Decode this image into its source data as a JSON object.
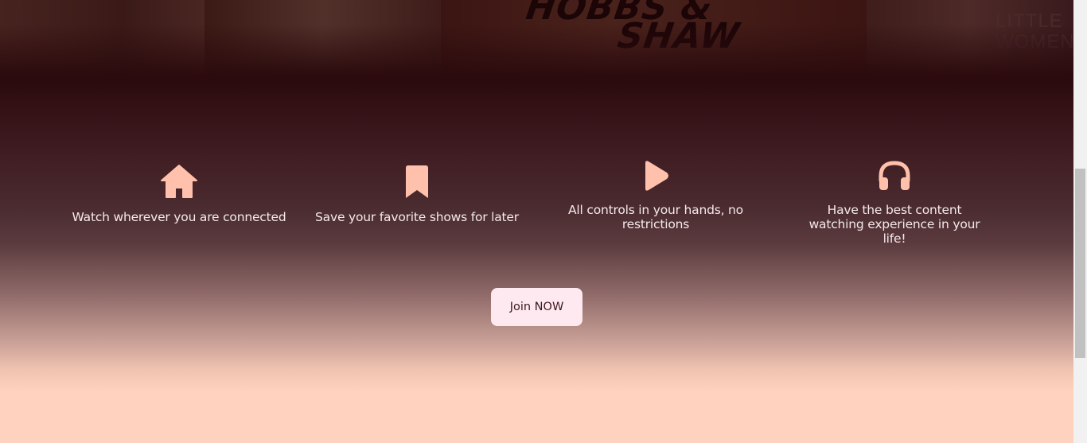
{
  "background": {
    "dark": "#2c0b0e",
    "light": "#ffd1bf",
    "accent": "#ffc1ab"
  },
  "posters": [
    {
      "name": "poster-1",
      "color": "#3a1a17"
    },
    {
      "name": "poster-2",
      "color": "#3e1c19"
    },
    {
      "name": "poster-hobbs-shaw",
      "color": "#3b1512",
      "logo_line1": "HOBBS &",
      "logo_line2": "SHAW"
    },
    {
      "name": "poster-little-women",
      "color": "#3a1a1c",
      "title_line1": "LITTLE",
      "title_line2": "WOMEN"
    }
  ],
  "features": [
    {
      "icon": "home-icon",
      "label": "Watch wherever you are connected"
    },
    {
      "icon": "bookmark-icon",
      "label": "Save your favorite shows for later"
    },
    {
      "icon": "play-icon",
      "label": "All controls in your hands, no restrictions"
    },
    {
      "icon": "headphones-icon",
      "label": "Have the best content watching experience in your life!"
    }
  ],
  "cta": {
    "label": "Join NOW"
  }
}
